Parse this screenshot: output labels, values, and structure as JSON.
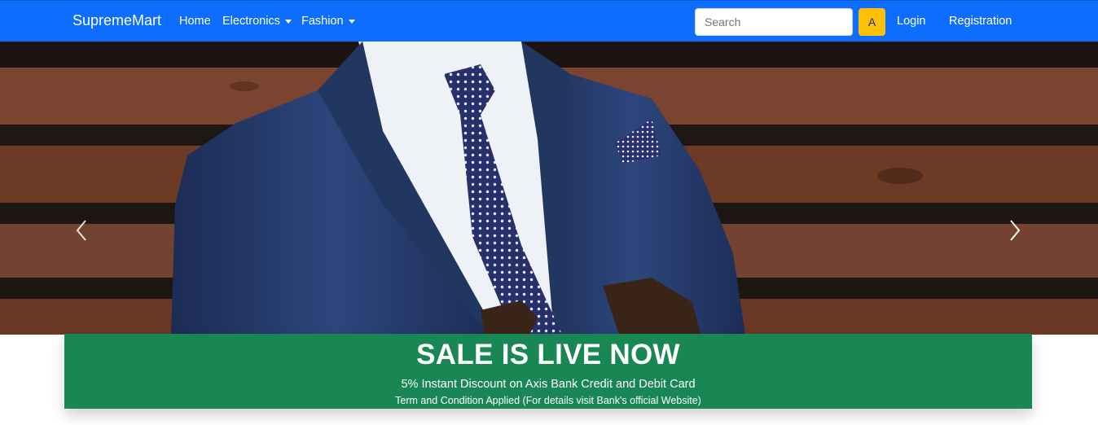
{
  "navbar": {
    "brand": "SupremeMart",
    "links": [
      {
        "label": "Home"
      },
      {
        "label": "Electronics"
      },
      {
        "label": "Fashion"
      }
    ],
    "search": {
      "placeholder": "Search",
      "value": "",
      "button_label": "A"
    },
    "login_label": "Login",
    "registration_label": "Registration",
    "colors": {
      "navbar": "#0d6efd",
      "search_button": "#ffc107"
    }
  },
  "carousel": {
    "prev_icon": "chevron-left-icon",
    "next_icon": "chevron-right-icon"
  },
  "sale_banner": {
    "title": "SALE IS LIVE NOW",
    "subtitle": "5% Instant Discount on Axis Bank Credit and Debit Card",
    "note": "Term and Condition Applied (For details visit Bank's official Website)",
    "color": "#198754"
  }
}
